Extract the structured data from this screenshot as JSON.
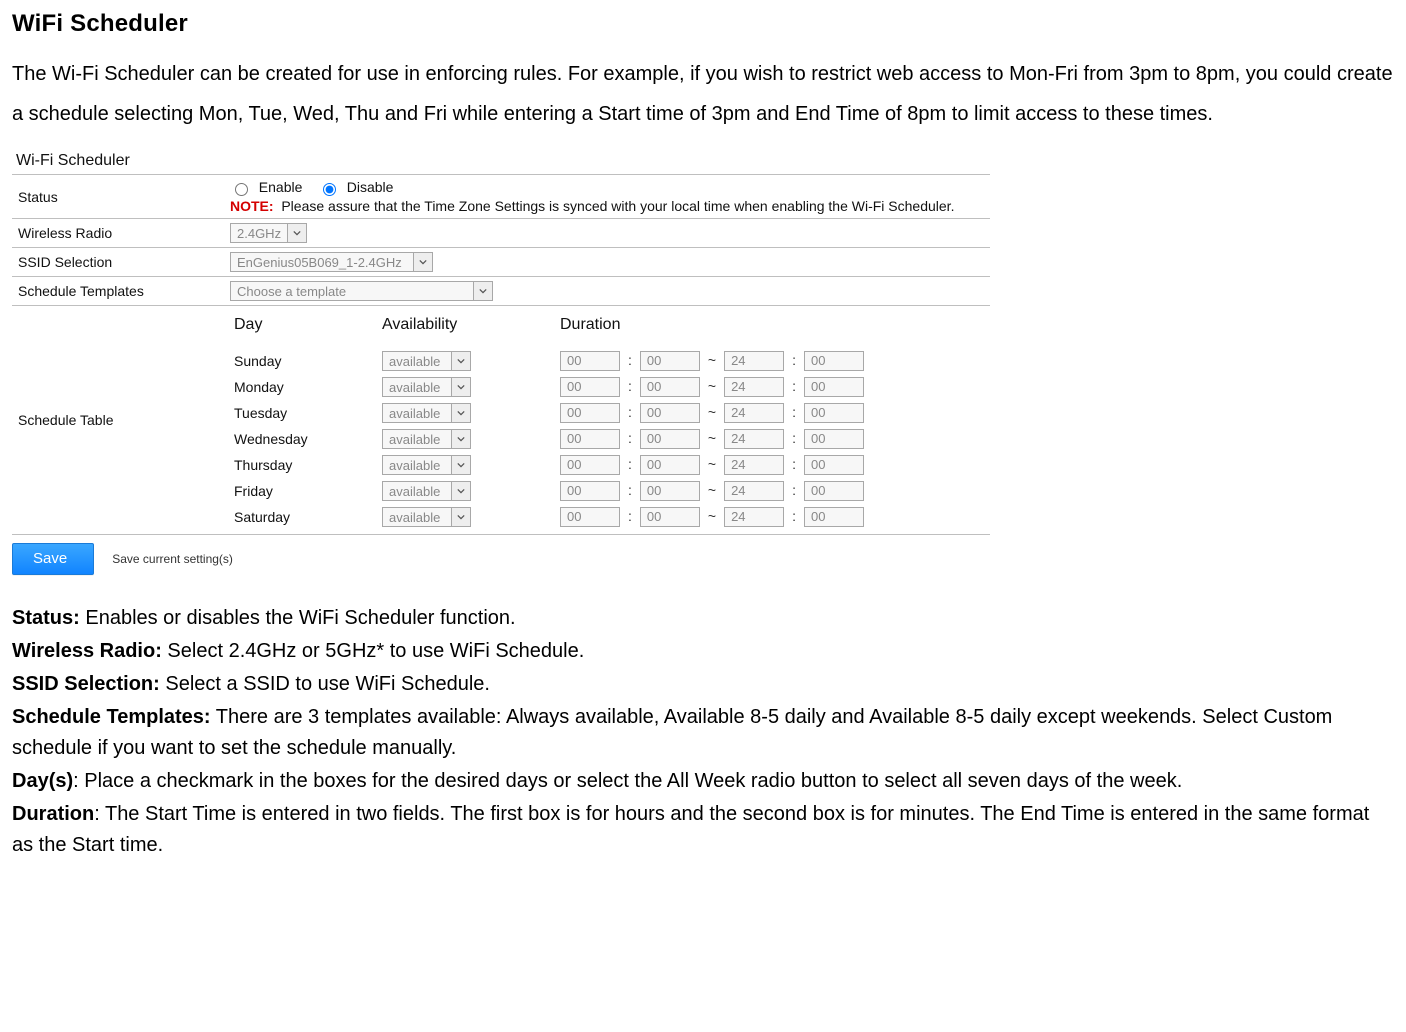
{
  "title": "WiFi Scheduler",
  "intro": "The Wi-Fi Scheduler can be created for use in enforcing rules. For example, if you wish to restrict web access to Mon-Fri from 3pm to 8pm, you could create a schedule selecting Mon, Tue, Wed, Thu and Fri while entering a Start time of 3pm and End Time of 8pm to limit access to these times.",
  "panel": {
    "header": "Wi-Fi Scheduler",
    "rows": {
      "status_label": "Status",
      "enable_label": "Enable",
      "disable_label": "Disable",
      "note_label": "NOTE:",
      "note_text": "Please assure that the Time Zone Settings is synced with your local time when enabling the Wi-Fi Scheduler.",
      "wireless_radio_label": "Wireless Radio",
      "wireless_radio_value": "2.4GHz",
      "ssid_label": "SSID Selection",
      "ssid_value": "EnGenius05B069_1-2.4GHz",
      "templates_label": "Schedule Templates",
      "templates_value": "Choose a template",
      "schedule_table_label": "Schedule Table"
    },
    "sched_headers": {
      "day": "Day",
      "availability": "Availability",
      "duration": "Duration"
    },
    "days": [
      {
        "name": "Sunday",
        "availability": "available",
        "sh": "00",
        "sm": "00",
        "eh": "24",
        "em": "00"
      },
      {
        "name": "Monday",
        "availability": "available",
        "sh": "00",
        "sm": "00",
        "eh": "24",
        "em": "00"
      },
      {
        "name": "Tuesday",
        "availability": "available",
        "sh": "00",
        "sm": "00",
        "eh": "24",
        "em": "00"
      },
      {
        "name": "Wednesday",
        "availability": "available",
        "sh": "00",
        "sm": "00",
        "eh": "24",
        "em": "00"
      },
      {
        "name": "Thursday",
        "availability": "available",
        "sh": "00",
        "sm": "00",
        "eh": "24",
        "em": "00"
      },
      {
        "name": "Friday",
        "availability": "available",
        "sh": "00",
        "sm": "00",
        "eh": "24",
        "em": "00"
      },
      {
        "name": "Saturday",
        "availability": "available",
        "sh": "00",
        "sm": "00",
        "eh": "24",
        "em": "00"
      }
    ],
    "save_label": "Save",
    "save_desc": "Save current setting(s)"
  },
  "defs": [
    {
      "term": "Status:",
      "text": " Enables or disables the WiFi Scheduler function."
    },
    {
      "term": "Wireless Radio:",
      "text": " Select 2.4GHz or 5GHz* to use WiFi Schedule."
    },
    {
      "term": "SSID Selection:",
      "text": " Select a SSID to use WiFi Schedule."
    },
    {
      "term": "Schedule Templates:",
      "text": " There are 3 templates available: Always available, Available 8-5 daily and Available 8-5 daily except weekends. Select Custom schedule if you want to set the schedule manually."
    },
    {
      "term": "Day(s)",
      "text": ": Place a checkmark in the boxes for the desired days or select the All Week radio button to select all seven days of the week."
    },
    {
      "term": "Duration",
      "text": ": The Start Time is entered in two fields. The first box is for hours and the second box is for minutes. The End Time is entered in the same format as the Start time."
    }
  ]
}
